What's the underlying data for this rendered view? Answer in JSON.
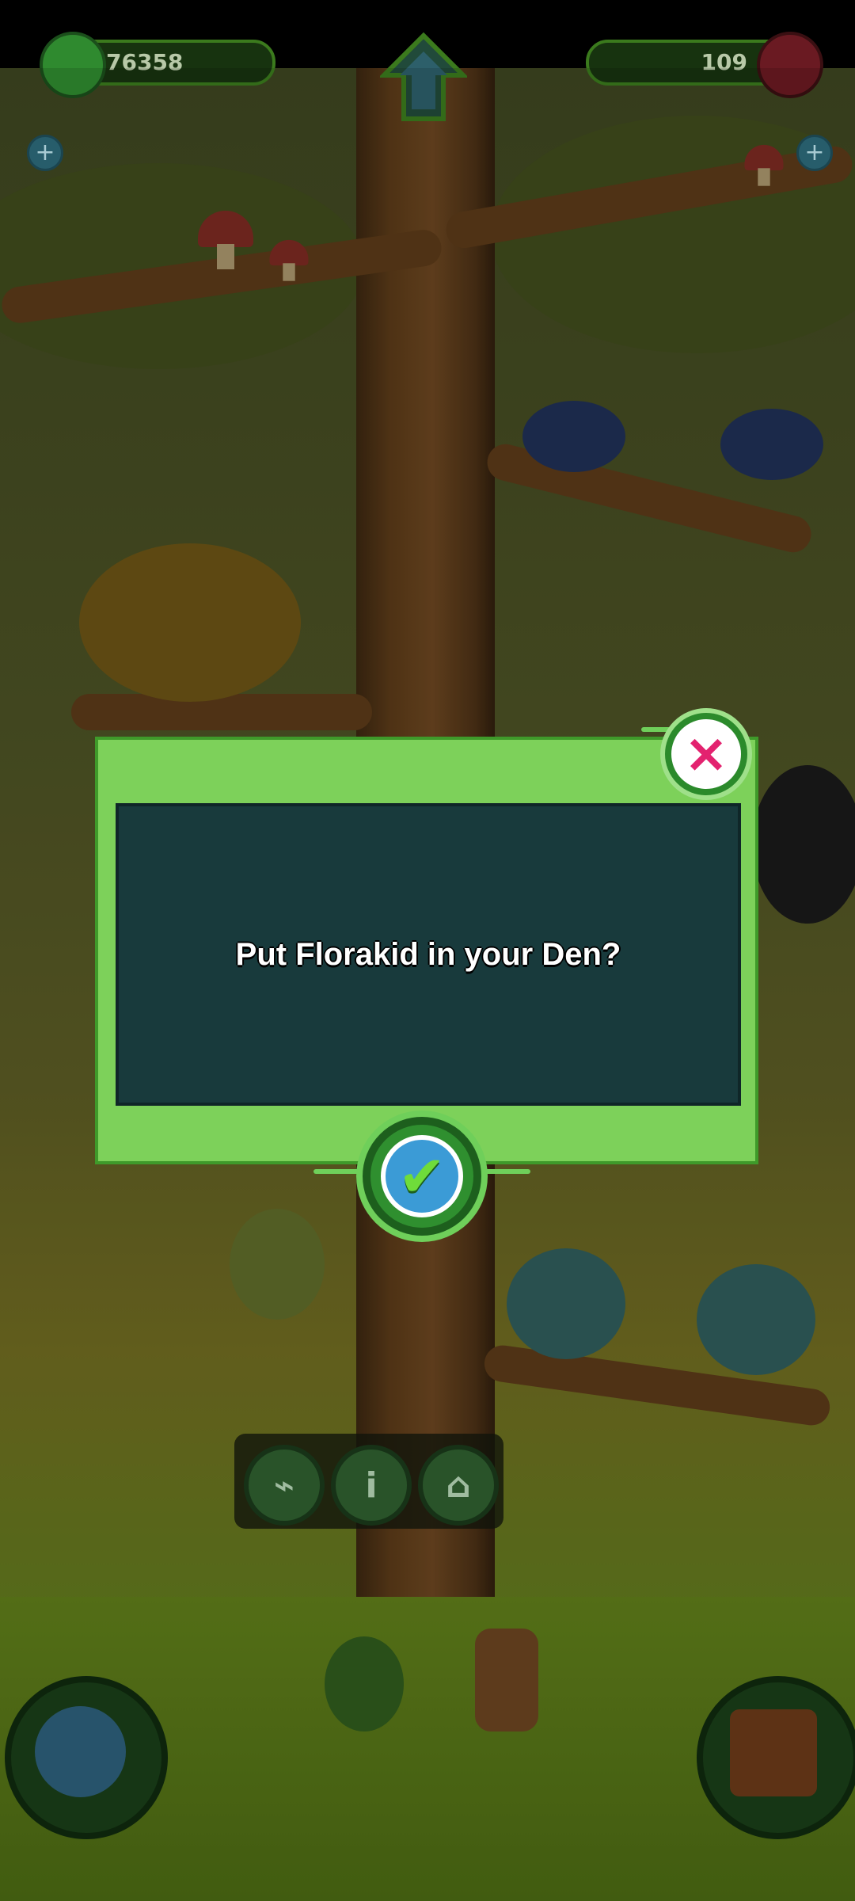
{
  "hud": {
    "gems_count": "76358",
    "crystals_count": "109",
    "plus_symbol": "+"
  },
  "dialog": {
    "message": "Put Florakid in your Den?"
  },
  "icons": {
    "close": "×",
    "confirm": "✔",
    "net": "⌁",
    "info": "i",
    "den": "⌂"
  },
  "colors": {
    "dialog_frame": "#7dd15a",
    "dialog_panel": "#183a3c",
    "close_x": "#e3226f",
    "confirm_check": "#6fdc3a"
  }
}
